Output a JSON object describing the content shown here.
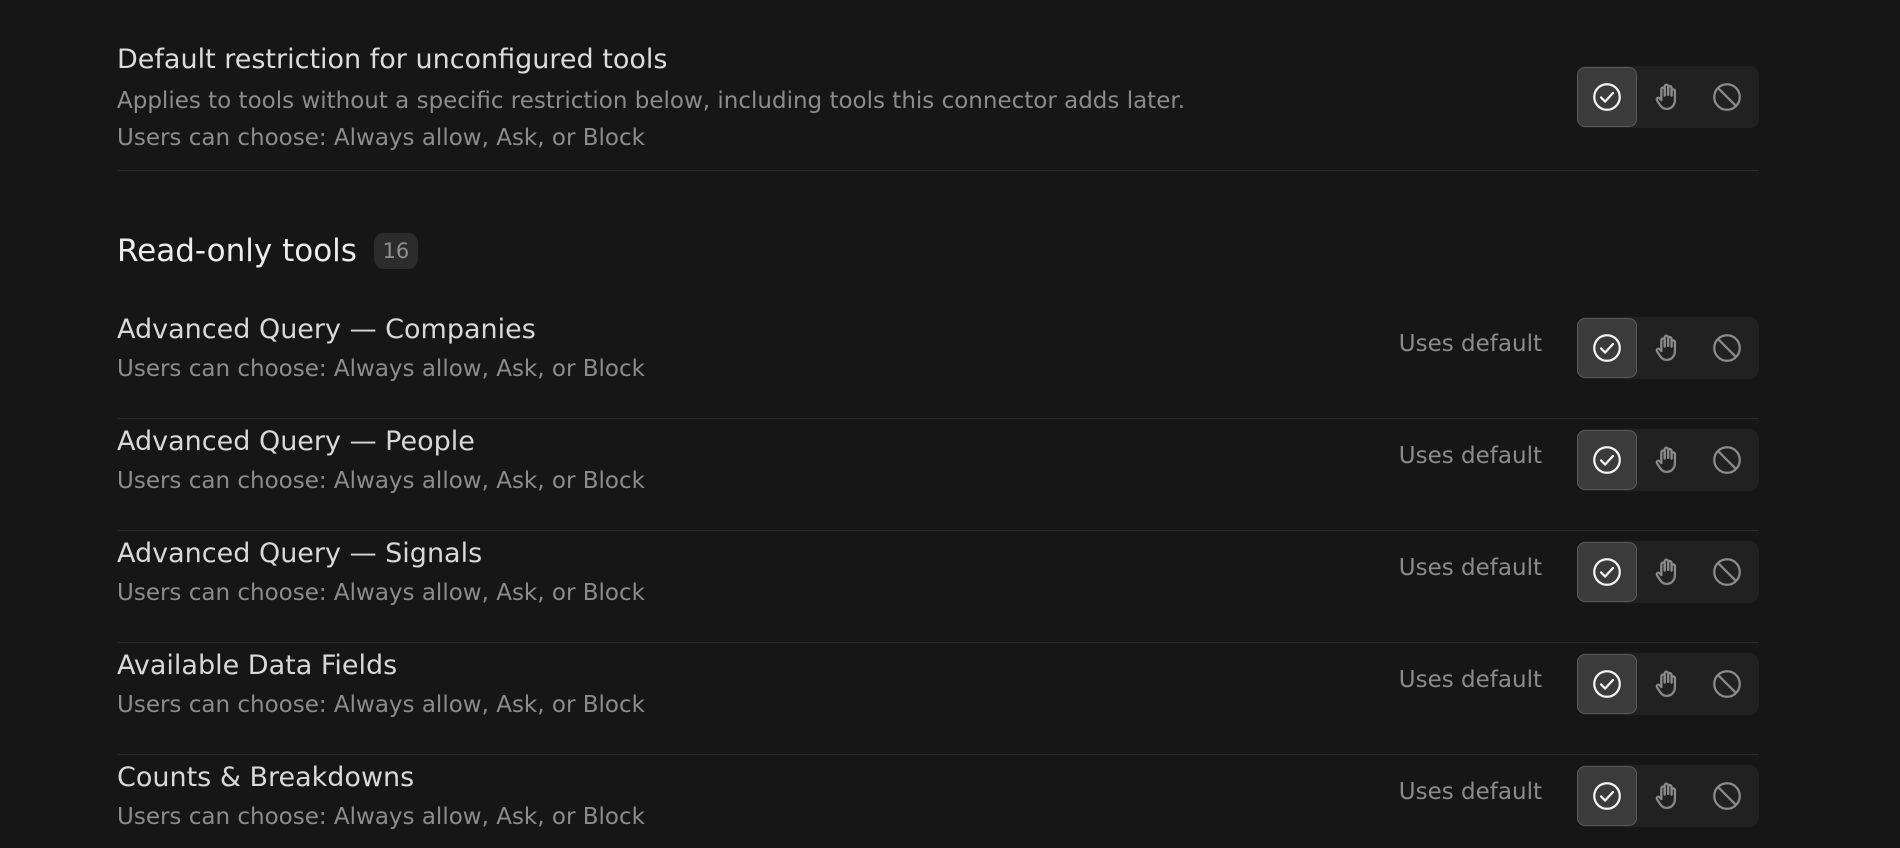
{
  "default_restriction": {
    "title": "Default restriction for unconfigured tools",
    "description": "Applies to tools without a specific restriction below, including tools this connector adds later.",
    "choices_text": "Users can choose: Always allow, Ask, or Block",
    "selected": "allow"
  },
  "section": {
    "title": "Read-only tools",
    "count": "16"
  },
  "tools": [
    {
      "name": "Advanced Query — Companies",
      "choices_text": "Users can choose: Always allow, Ask, or Block",
      "status": "Uses default",
      "selected": "allow"
    },
    {
      "name": "Advanced Query — People",
      "choices_text": "Users can choose: Always allow, Ask, or Block",
      "status": "Uses default",
      "selected": "allow"
    },
    {
      "name": "Advanced Query — Signals",
      "choices_text": "Users can choose: Always allow, Ask, or Block",
      "status": "Uses default",
      "selected": "allow"
    },
    {
      "name": "Available Data Fields",
      "choices_text": "Users can choose: Always allow, Ask, or Block",
      "status": "Uses default",
      "selected": "allow"
    },
    {
      "name": "Counts & Breakdowns",
      "choices_text": "Users can choose: Always allow, Ask, or Block",
      "status": "Uses default",
      "selected": "allow"
    }
  ],
  "segment_options": [
    {
      "key": "allow",
      "icon": "check-circle-icon"
    },
    {
      "key": "ask",
      "icon": "hand-icon"
    },
    {
      "key": "block",
      "icon": "block-icon"
    }
  ],
  "colors": {
    "background": "#161616",
    "segment_bg": "#212121",
    "segment_active": "#3b3b3b",
    "icon_active": "#f2f2f2",
    "icon_inactive": "#8a8a8a"
  }
}
